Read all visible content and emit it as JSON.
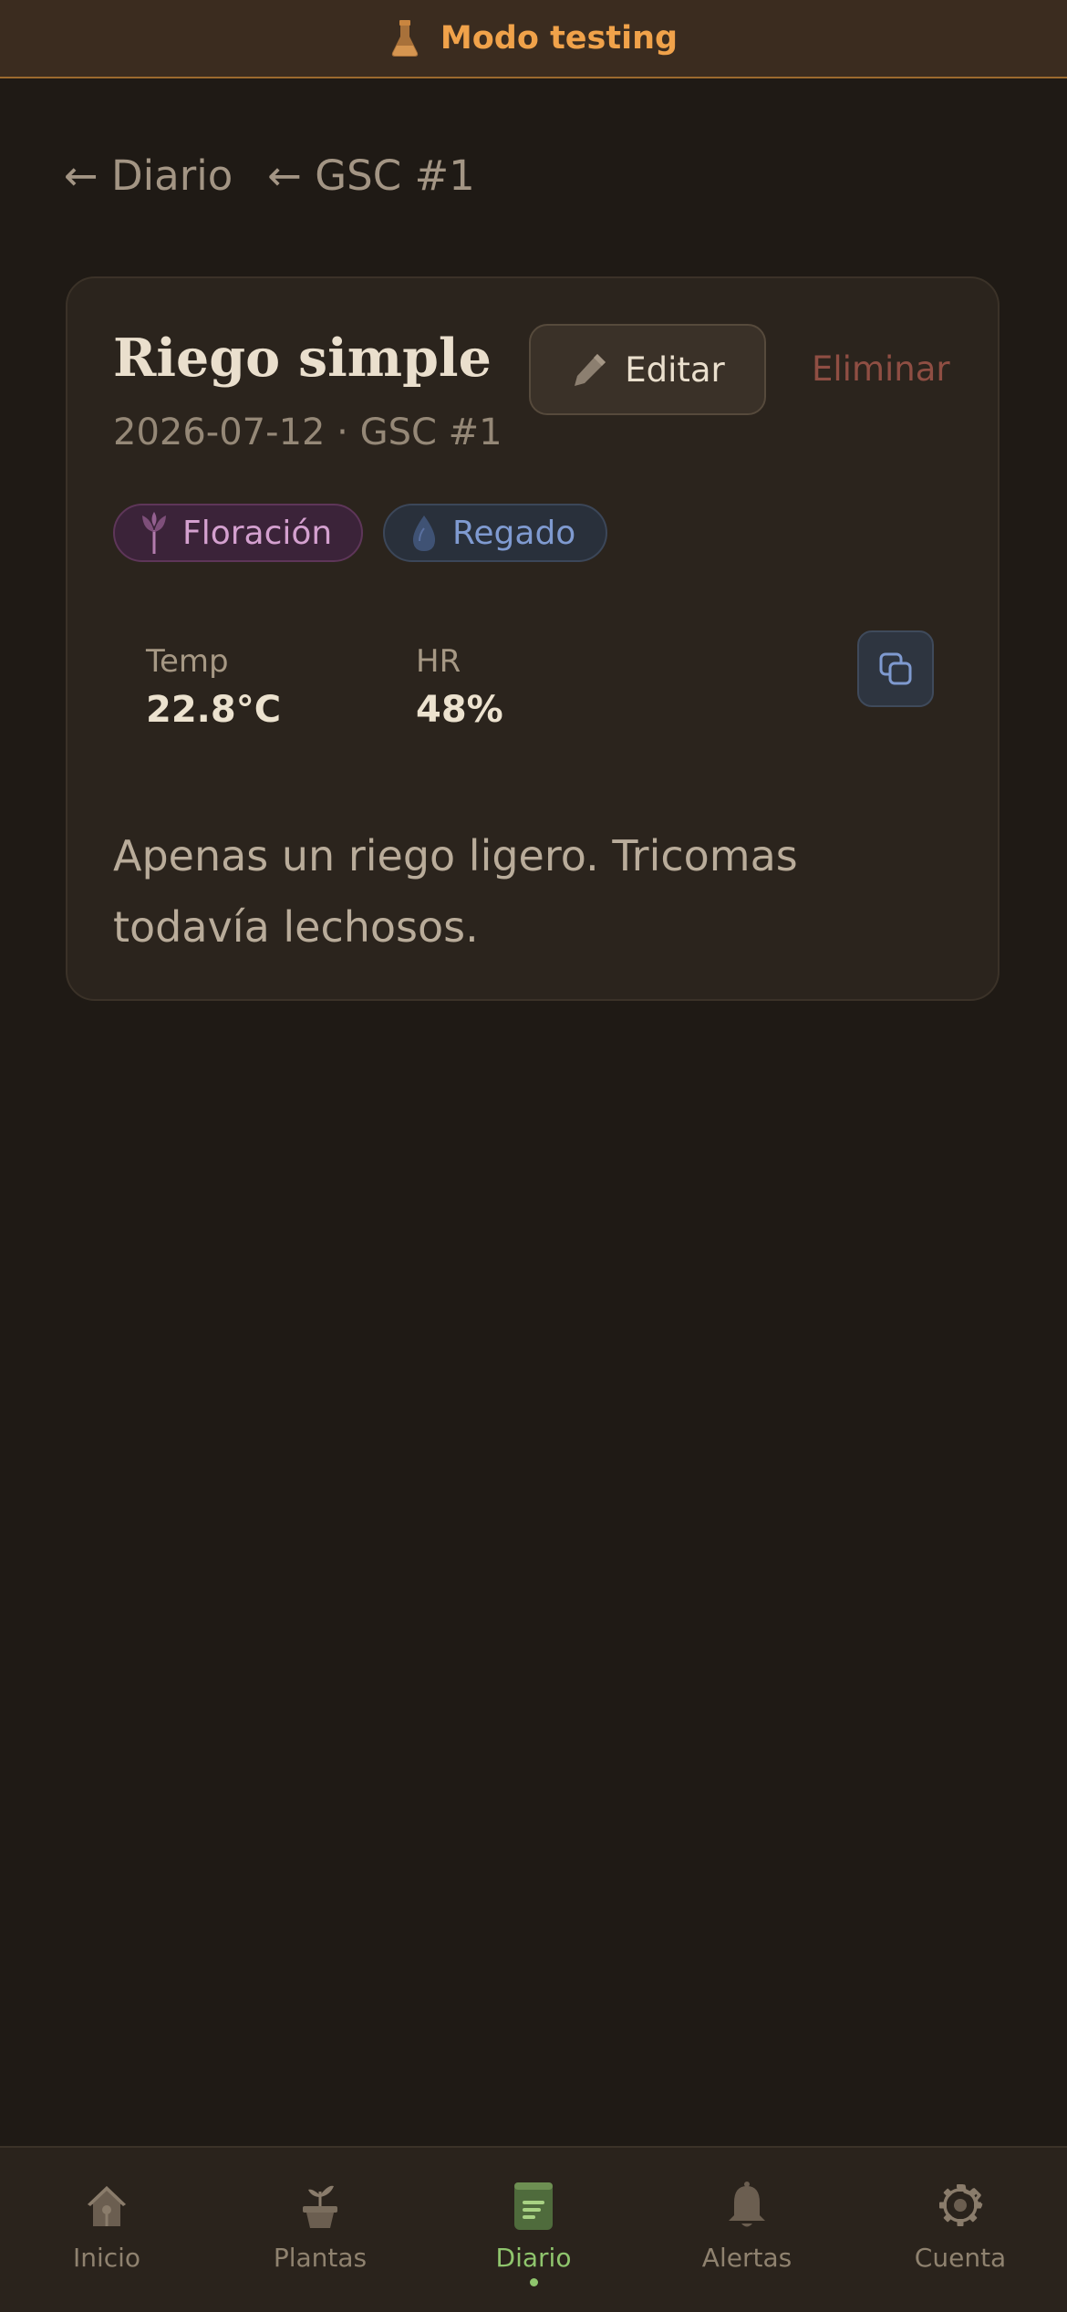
{
  "test_banner": {
    "label": "Modo testing",
    "icon": "flask-icon",
    "accent": "#f0a24a"
  },
  "breadcrumbs": [
    "← Diario",
    "← GSC #1"
  ],
  "entry": {
    "title": "Riego simple",
    "subtitle": "2026-07-12 · GSC #1",
    "edit_label": "Editar",
    "delete_label": "Eliminar",
    "tags": [
      {
        "label": "Floración",
        "icon": "flower-stem-icon",
        "color": "#d4a0cf"
      },
      {
        "label": "Regado",
        "icon": "water-drop-icon",
        "color": "#7f9ad0"
      }
    ],
    "metrics": [
      {
        "label": "Temp",
        "value": "22.8°C"
      },
      {
        "label": "HR",
        "value": "48%"
      }
    ],
    "notes": "Apenas un riego ligero. Tricomas todavía lechosos."
  },
  "nav": {
    "active_color": "#8fc56d",
    "items": [
      {
        "label": "Inicio",
        "icon": "home-icon",
        "active": false
      },
      {
        "label": "Plantas",
        "icon": "plant-pot-icon",
        "active": false
      },
      {
        "label": "Diario",
        "icon": "journal-icon",
        "active": true
      },
      {
        "label": "Alertas",
        "icon": "bell-icon",
        "active": false
      },
      {
        "label": "Cuenta",
        "icon": "gear-icon",
        "active": false
      }
    ]
  }
}
